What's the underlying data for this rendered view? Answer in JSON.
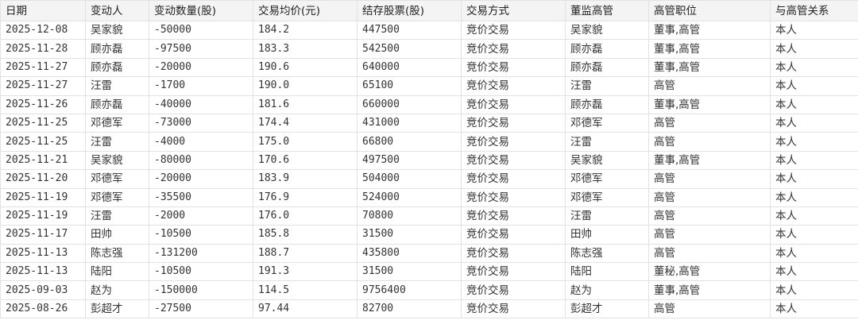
{
  "columns": [
    "日期",
    "变动人",
    "变动数量(股)",
    "交易均价(元)",
    "结存股票(股)",
    "交易方式",
    "董监高管",
    "高管职位",
    "与高管关系"
  ],
  "rows": [
    [
      "2025-12-08",
      "吴家貌",
      "-50000",
      "184.2",
      "447500",
      "竞价交易",
      "吴家貌",
      "董事,高管",
      "本人"
    ],
    [
      "2025-11-28",
      "顾亦磊",
      "-97500",
      "183.3",
      "542500",
      "竞价交易",
      "顾亦磊",
      "董事,高管",
      "本人"
    ],
    [
      "2025-11-27",
      "顾亦磊",
      "-20000",
      "190.6",
      "640000",
      "竞价交易",
      "顾亦磊",
      "董事,高管",
      "本人"
    ],
    [
      "2025-11-27",
      "汪雷",
      "-1700",
      "190.0",
      "65100",
      "竞价交易",
      "汪雷",
      "高管",
      "本人"
    ],
    [
      "2025-11-26",
      "顾亦磊",
      "-40000",
      "181.6",
      "660000",
      "竞价交易",
      "顾亦磊",
      "董事,高管",
      "本人"
    ],
    [
      "2025-11-25",
      "邓德军",
      "-73000",
      "174.4",
      "431000",
      "竞价交易",
      "邓德军",
      "高管",
      "本人"
    ],
    [
      "2025-11-25",
      "汪雷",
      "-4000",
      "175.0",
      "66800",
      "竞价交易",
      "汪雷",
      "高管",
      "本人"
    ],
    [
      "2025-11-21",
      "吴家貌",
      "-80000",
      "170.6",
      "497500",
      "竞价交易",
      "吴家貌",
      "董事,高管",
      "本人"
    ],
    [
      "2025-11-20",
      "邓德军",
      "-20000",
      "183.9",
      "504000",
      "竞价交易",
      "邓德军",
      "高管",
      "本人"
    ],
    [
      "2025-11-19",
      "邓德军",
      "-35500",
      "176.9",
      "524000",
      "竞价交易",
      "邓德军",
      "高管",
      "本人"
    ],
    [
      "2025-11-19",
      "汪雷",
      "-2000",
      "176.0",
      "70800",
      "竞价交易",
      "汪雷",
      "高管",
      "本人"
    ],
    [
      "2025-11-17",
      "田帅",
      "-10500",
      "185.8",
      "31500",
      "竞价交易",
      "田帅",
      "高管",
      "本人"
    ],
    [
      "2025-11-13",
      "陈志强",
      "-131200",
      "188.7",
      "435800",
      "竞价交易",
      "陈志强",
      "高管",
      "本人"
    ],
    [
      "2025-11-13",
      "陆阳",
      "-10500",
      "191.3",
      "31500",
      "竞价交易",
      "陆阳",
      "董秘,高管",
      "本人"
    ],
    [
      "2025-09-03",
      "赵为",
      "-150000",
      "114.5",
      "9756400",
      "竞价交易",
      "赵为",
      "董事,高管",
      "本人"
    ],
    [
      "2025-08-26",
      "彭超才",
      "-27500",
      "97.44",
      "82700",
      "竞价交易",
      "彭超才",
      "高管",
      "本人"
    ]
  ]
}
